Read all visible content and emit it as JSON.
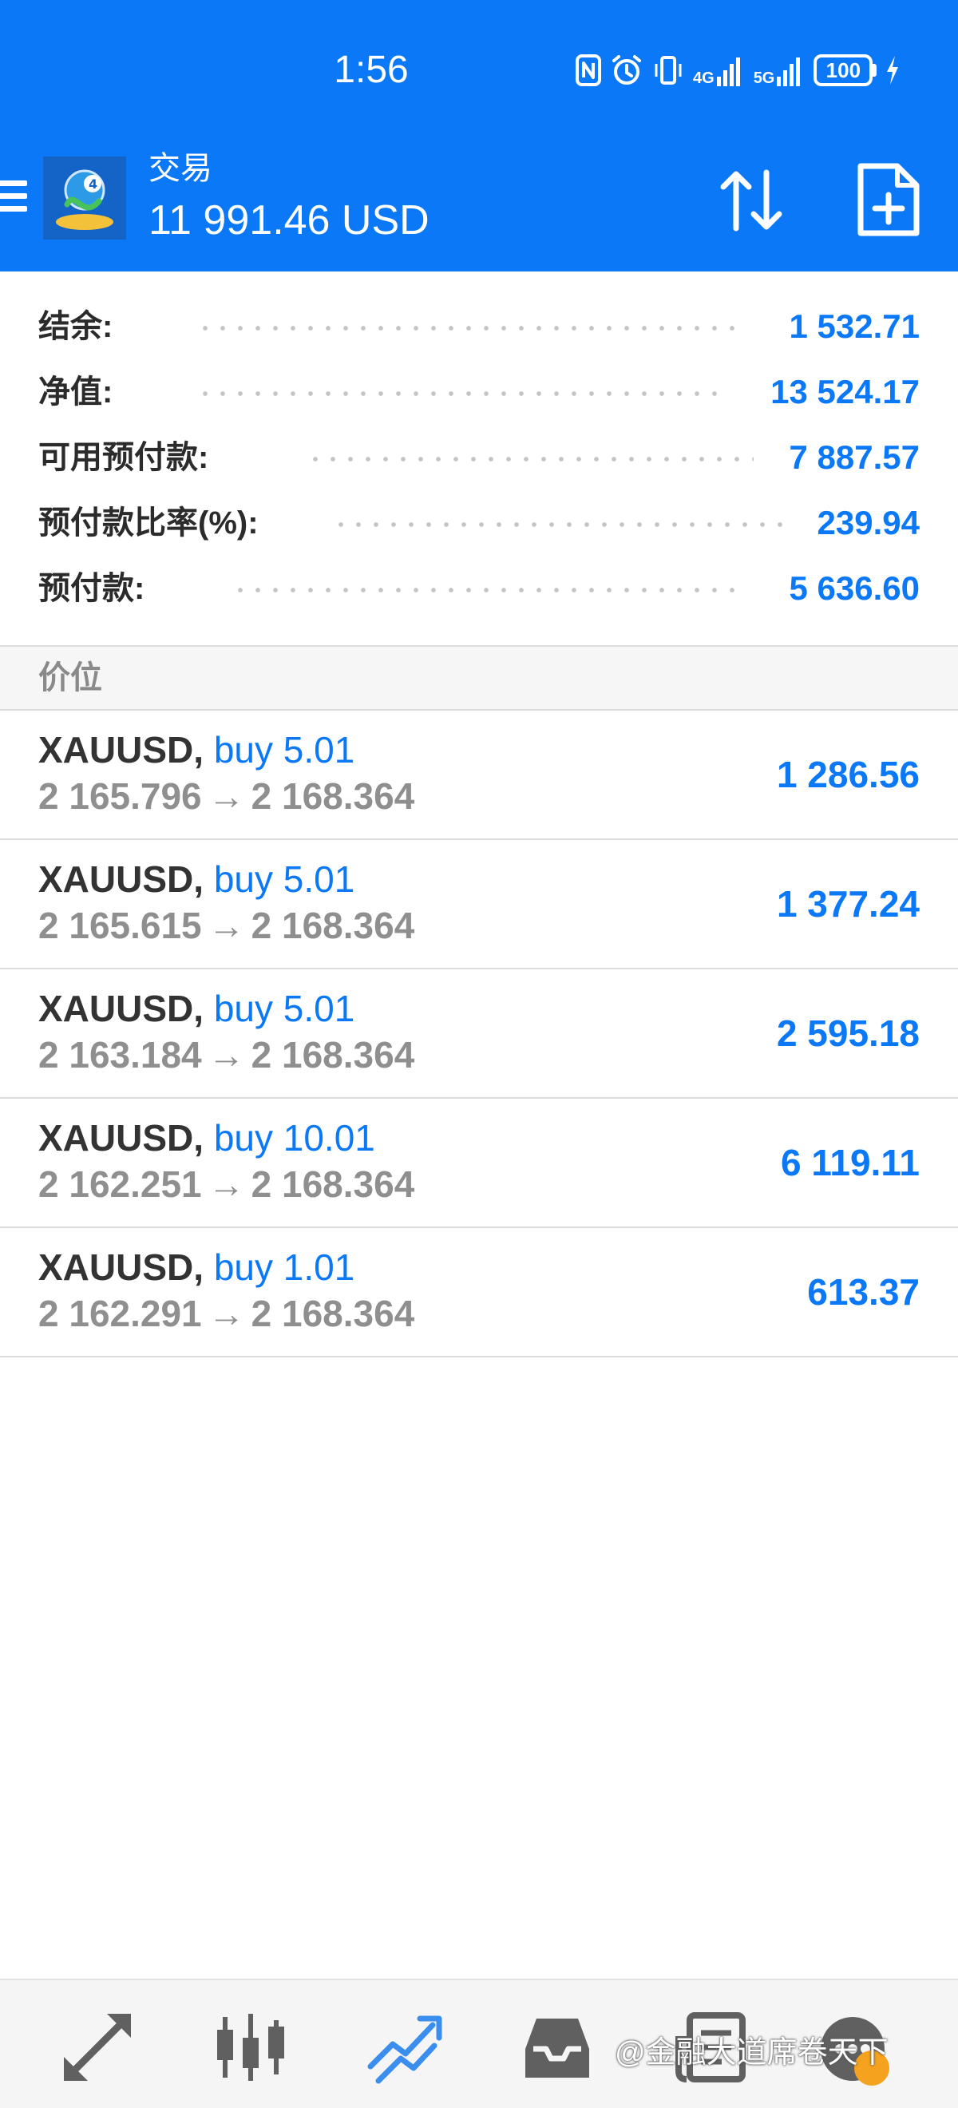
{
  "status_bar": {
    "time": "1:56",
    "network_1": "4G",
    "network_2": "5G",
    "battery": "100"
  },
  "header": {
    "title": "交易",
    "balance": "11 991.46 USD"
  },
  "account": [
    {
      "label": "结余:",
      "value": "1 532.71"
    },
    {
      "label": "净值:",
      "value": "13 524.17"
    },
    {
      "label": "可用预付款:",
      "value": "7 887.57"
    },
    {
      "label": "预付款比率(%):",
      "value": "239.94"
    },
    {
      "label": "预付款:",
      "value": "5 636.60"
    }
  ],
  "section": {
    "title": "价位"
  },
  "positions": [
    {
      "symbol": "XAUUSD,",
      "direction": "buy 5.01",
      "open_price": "2 165.796",
      "current_price": "2 168.364",
      "profit": "1 286.56"
    },
    {
      "symbol": "XAUUSD,",
      "direction": "buy 5.01",
      "open_price": "2 165.615",
      "current_price": "2 168.364",
      "profit": "1 377.24"
    },
    {
      "symbol": "XAUUSD,",
      "direction": "buy 5.01",
      "open_price": "2 163.184",
      "current_price": "2 168.364",
      "profit": "2 595.18"
    },
    {
      "symbol": "XAUUSD,",
      "direction": "buy 10.01",
      "open_price": "2 162.251",
      "current_price": "2 168.364",
      "profit": "6 119.11"
    },
    {
      "symbol": "XAUUSD,",
      "direction": "buy 1.01",
      "open_price": "2 162.291",
      "current_price": "2 168.364",
      "profit": "613.37"
    }
  ],
  "arrow_symbol": "→",
  "watermark": "@金融大道席卷天下",
  "colors": {
    "primary": "#0b79f7",
    "label_text": "#2b2b2b",
    "secondary_text": "#8f8f8f"
  },
  "icons": {
    "menu": "hamburger-icon",
    "sort": "sort-arrows-icon",
    "new_order": "file-plus-icon",
    "nav": [
      "quotes-icon",
      "chart-icon",
      "trade-icon",
      "history-icon",
      "news-icon",
      "settings-icon"
    ]
  }
}
